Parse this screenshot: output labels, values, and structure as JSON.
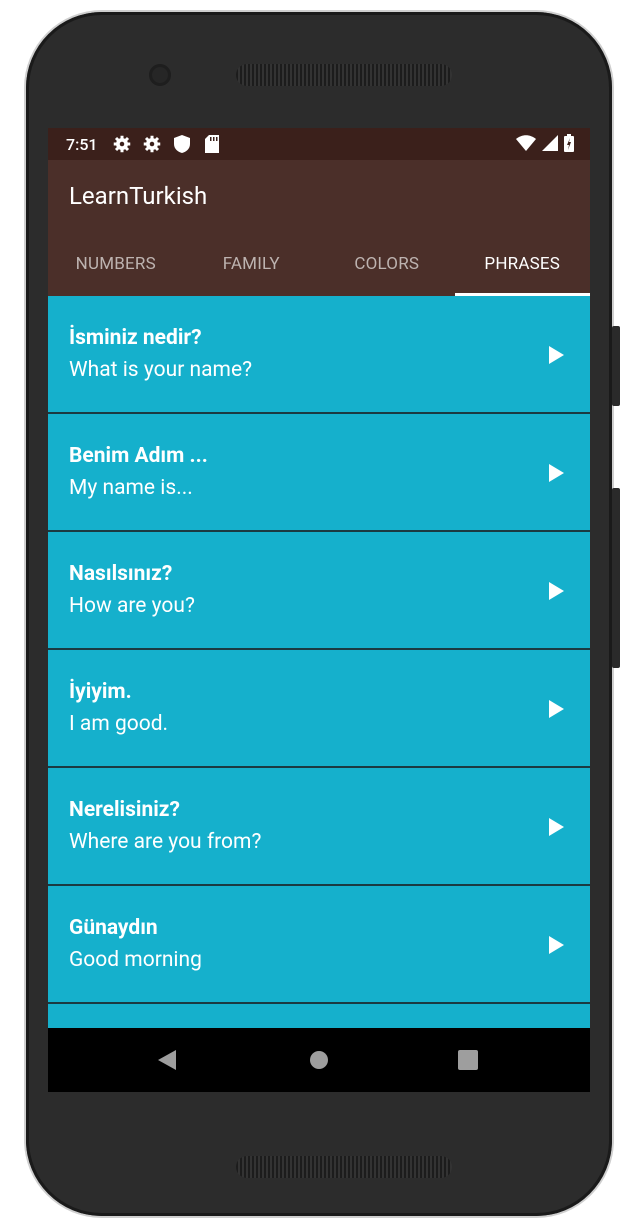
{
  "status_bar": {
    "time": "7:51"
  },
  "app": {
    "title": "LearnTurkish"
  },
  "tabs": [
    {
      "label": "NUMBERS"
    },
    {
      "label": "FAMILY"
    },
    {
      "label": "COLORS"
    },
    {
      "label": "PHRASES",
      "active": true
    }
  ],
  "phrases": [
    {
      "turkish": "İsminiz nedir?",
      "english": "What is your name?"
    },
    {
      "turkish": "Benim Adım ...",
      "english": "My name is..."
    },
    {
      "turkish": "Nasılsınız?",
      "english": "How are you?"
    },
    {
      "turkish": "İyiyim.",
      "english": "I am good."
    },
    {
      "turkish": "Nerelisiniz?",
      "english": "Where are you from?"
    },
    {
      "turkish": "Günaydın",
      "english": "Good morning"
    }
  ],
  "colors": {
    "status_bar": "#3b201b",
    "app_bar": "#4b2f29",
    "list_bg": "#15b0cc",
    "divider": "#1b3a41"
  },
  "icons": {
    "play": "play-icon",
    "nav": [
      "back-icon",
      "home-icon",
      "recents-icon"
    ]
  }
}
